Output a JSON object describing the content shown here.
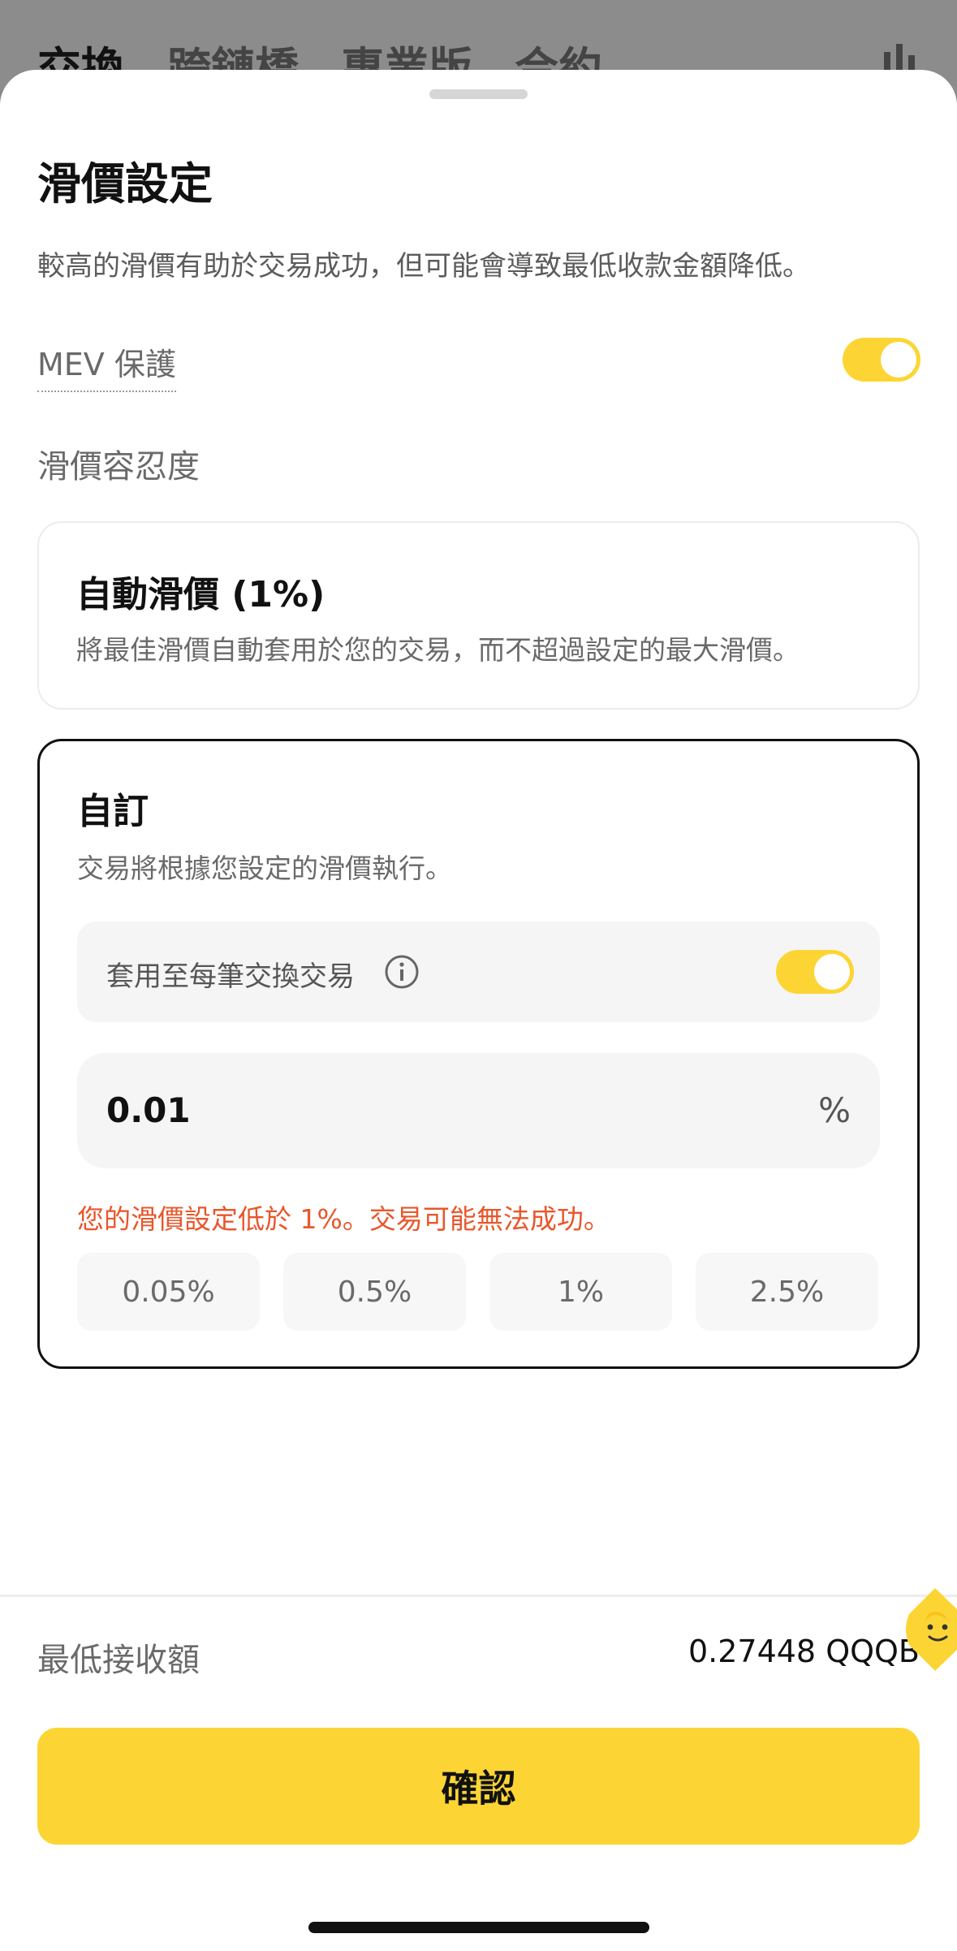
{
  "background_header": {
    "tabs": [
      "交換",
      "跨鏈橋",
      "專業版",
      "合約"
    ],
    "active_tab": 0,
    "chart_icon": "bar-chart-icon"
  },
  "sheet": {
    "title": "滑價設定",
    "description": "較高的滑價有助於交易成功，但可能會導致最低收款金額降低。",
    "mev_protection": {
      "label": "MEV 保護",
      "enabled": true
    },
    "tolerance_label": "滑價容忍度",
    "auto_option": {
      "title": "自動滑價 (1%)",
      "description": "將最佳滑價自動套用於您的交易，而不超過設定的最大滑價。"
    },
    "custom_option": {
      "title": "自訂",
      "description": "交易將根據您設定的滑價執行。",
      "apply_all": {
        "label": "套用至每筆交換交易",
        "enabled": true,
        "info_icon": "info-icon"
      },
      "input_value": "0.01",
      "input_unit": "%",
      "warning": "您的滑價設定低於 1%。交易可能無法成功。",
      "presets": [
        "0.05%",
        "0.5%",
        "1%",
        "2.5%"
      ]
    },
    "minimum_received": {
      "label": "最低接收額",
      "value": "0.27448 QQQB"
    },
    "confirm_label": "確認"
  },
  "colors": {
    "accent_yellow": "#FCD535",
    "warning_orange": "#E8572B",
    "text_primary": "#111111",
    "text_secondary": "#6A6A6A"
  }
}
